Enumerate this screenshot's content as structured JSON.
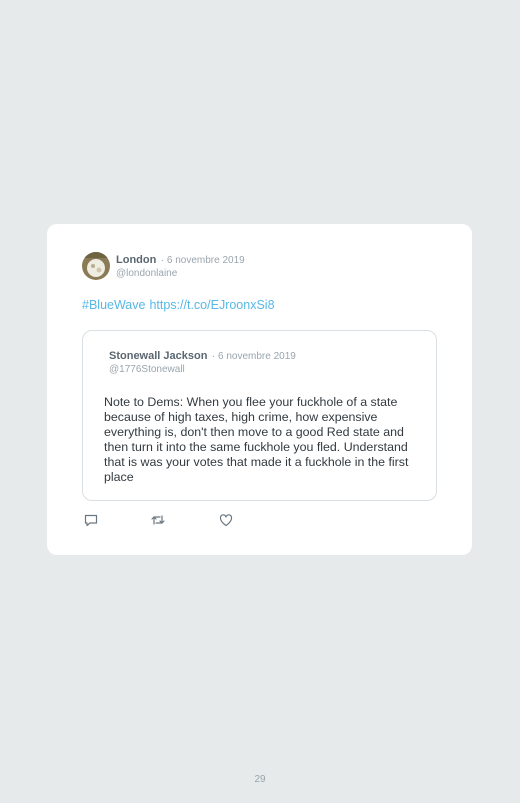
{
  "tweet": {
    "author_name": "London",
    "date": "· 6 novembre 2019",
    "handle": "@londonlaine",
    "hashtag": "#BlueWave",
    "link": "https://t.co/EJroonxSi8"
  },
  "quoted": {
    "author_name": "Stonewall Jackson",
    "date": "· 6 novembre 2019",
    "handle": "@1776Stonewall",
    "text": "Note to Dems: When you flee your fuckhole of a state because of high taxes, high crime, how expensive everything is, don't then move to a good Red state and then turn it into the same fuckhole you fled. Understand that is was your votes that made it a fuckhole in the first place"
  },
  "actions": [
    {
      "icon": "reply-icon"
    },
    {
      "icon": "retweet-icon"
    },
    {
      "icon": "like-icon"
    }
  ],
  "page_number": "29",
  "colors": {
    "background": "#e6eaeb",
    "link": "#57b8e6",
    "muted": "#9aa5ad"
  }
}
